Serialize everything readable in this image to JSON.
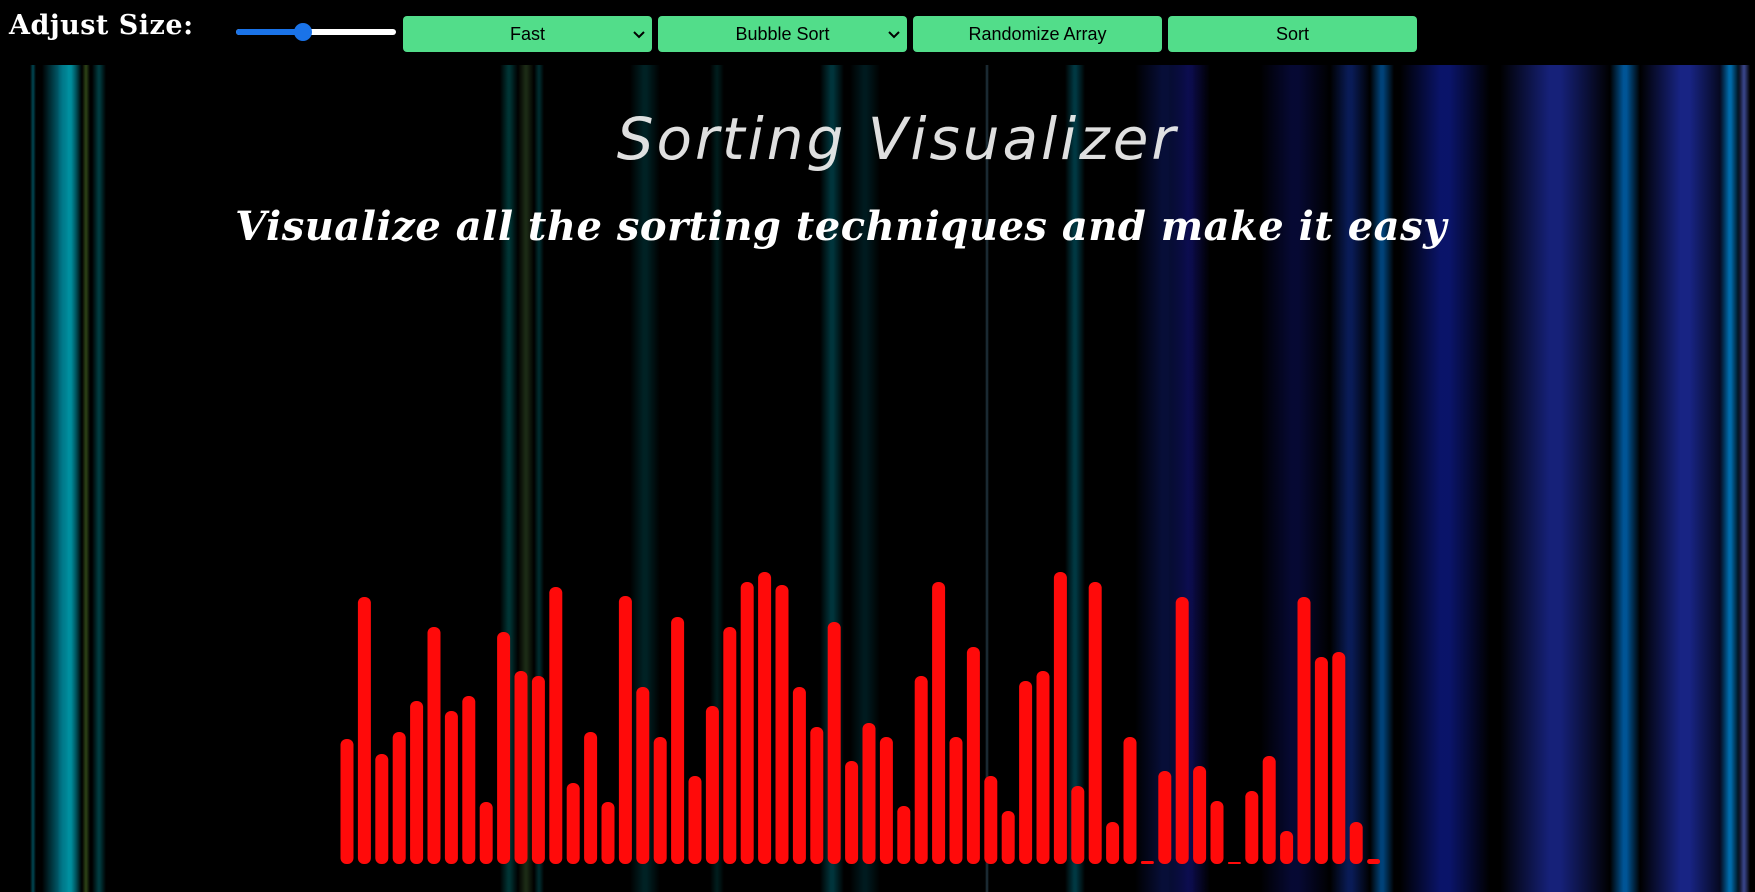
{
  "toolbar": {
    "size_label": "Adjust Size:",
    "size_slider_value": 0.42,
    "speed": {
      "selected": "Fast"
    },
    "algorithm": {
      "selected": "Bubble Sort"
    },
    "randomize_label": "Randomize Array",
    "sort_label": "Sort"
  },
  "hero": {
    "title": "Sorting Visualizer",
    "subtitle": "Visualize all the sorting techniques and make it easy"
  },
  "colors": {
    "control_green": "#52dd8a",
    "bar_red": "#ff0a0a",
    "slider_blue": "#1a73e8"
  },
  "icons": [
    "chevron-down-icon"
  ],
  "chart_data": {
    "type": "bar",
    "values": [
      125,
      267,
      110,
      132,
      163,
      237,
      153,
      168,
      62,
      232,
      193,
      188,
      277,
      81,
      132,
      62,
      268,
      177,
      127,
      247,
      88,
      158,
      237,
      282,
      292,
      279,
      177,
      137,
      242,
      103,
      141,
      127,
      58,
      188,
      282,
      127,
      217,
      88,
      53,
      183,
      193,
      292,
      78,
      282,
      42,
      127,
      3,
      93,
      267,
      98,
      63,
      2,
      73,
      108,
      33,
      267,
      207,
      212,
      42,
      5
    ]
  }
}
